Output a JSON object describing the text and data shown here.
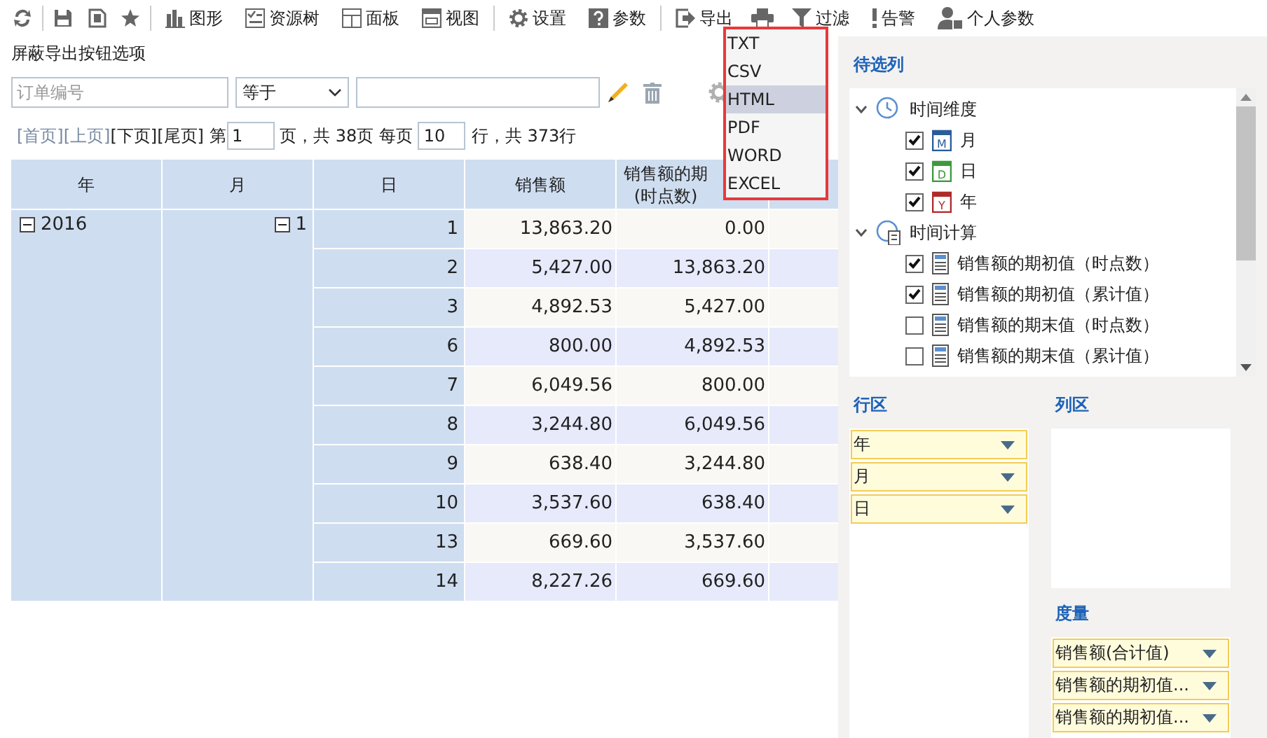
{
  "toolbar": {
    "buttons": [
      "图形",
      "资源树",
      "面板",
      "视图",
      "设置",
      "参数",
      "导出",
      "过滤",
      "告警",
      "个人参数"
    ]
  },
  "export_menu": {
    "items": [
      {
        "label": "TXT",
        "selected": false
      },
      {
        "label": "CSV",
        "selected": false
      },
      {
        "label": "HTML",
        "selected": true
      },
      {
        "label": "PDF",
        "selected": false
      },
      {
        "label": "WORD",
        "selected": false
      },
      {
        "label": "EXCEL",
        "selected": false
      }
    ]
  },
  "hint": "屏蔽导出按钮选项",
  "filter": {
    "field": {
      "placeholder": "订单编号"
    },
    "operator": "等于"
  },
  "pager": {
    "links": [
      {
        "label": "[首页]",
        "disabled": true
      },
      {
        "label": "[上页]",
        "disabled": true
      },
      {
        "label": "[下页]",
        "disabled": false
      },
      {
        "label": "[尾页]",
        "disabled": false
      }
    ],
    "page_prefix": "第",
    "page": "1",
    "page_suffix": "页，共 38页 每页",
    "per_page": "10",
    "rows_suffix": "行，共 373行"
  },
  "table": {
    "columns": [
      "年",
      "月",
      "日",
      "销售额",
      [
        "销售额的期",
        "(时点数)"
      ]
    ],
    "year": "2016",
    "month": "1",
    "rows": [
      {
        "day": "1",
        "sales": "13,863.20",
        "opening": "0.00"
      },
      {
        "day": "2",
        "sales": "5,427.00",
        "opening": "13,863.20"
      },
      {
        "day": "3",
        "sales": "4,892.53",
        "opening": "5,427.00"
      },
      {
        "day": "6",
        "sales": "800.00",
        "opening": "4,892.53"
      },
      {
        "day": "7",
        "sales": "6,049.56",
        "opening": "800.00"
      },
      {
        "day": "8",
        "sales": "3,244.80",
        "opening": "6,049.56"
      },
      {
        "day": "9",
        "sales": "638.40",
        "opening": "3,244.80"
      },
      {
        "day": "10",
        "sales": "3,537.60",
        "opening": "638.40"
      },
      {
        "day": "13",
        "sales": "669.60",
        "opening": "3,537.60"
      },
      {
        "day": "14",
        "sales": "8,227.26",
        "opening": "669.60"
      }
    ]
  },
  "candidates": {
    "title": "待选列",
    "tree": [
      {
        "label": "时间维度",
        "expanded": true,
        "children": [
          {
            "label": "月",
            "checked": true,
            "kind": "date",
            "badge": "M",
            "color": "#2a5c9a"
          },
          {
            "label": "日",
            "checked": true,
            "kind": "date",
            "badge": "D",
            "color": "#3c9a3c"
          },
          {
            "label": "年",
            "checked": true,
            "kind": "date",
            "badge": "Y",
            "color": "#b02a2a"
          }
        ]
      },
      {
        "label": "时间计算",
        "expanded": true,
        "children": [
          {
            "label": "销售额的期初值（时点数）",
            "checked": true,
            "kind": "measure"
          },
          {
            "label": "销售额的期初值（累计值）",
            "checked": true,
            "kind": "measure"
          },
          {
            "label": "销售额的期末值（时点数）",
            "checked": false,
            "kind": "measure"
          },
          {
            "label": "销售额的期末值（累计值）",
            "checked": false,
            "kind": "measure"
          }
        ]
      }
    ]
  },
  "row_zone": {
    "title": "行区",
    "items": [
      "年",
      "月",
      "日"
    ]
  },
  "column_zone": {
    "title": "列区"
  },
  "measures": {
    "title": "度量",
    "items": [
      "销售额(合计值)",
      "销售额的期初值...",
      "销售额的期初值..."
    ]
  }
}
